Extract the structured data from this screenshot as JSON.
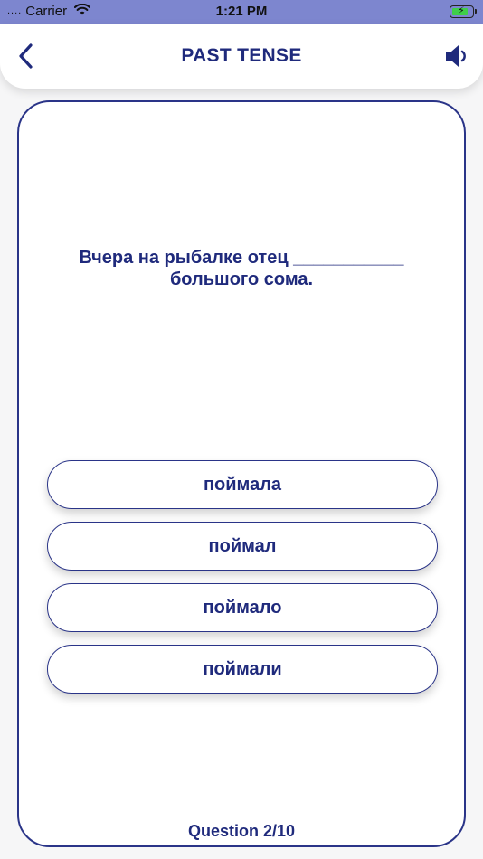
{
  "status_bar": {
    "carrier": "Carrier",
    "time": "1:21 PM",
    "signal_dots": "....",
    "battery_icon": "battery-charging-icon",
    "wifi_icon": "wifi-icon"
  },
  "header": {
    "title": "PAST TENSE",
    "back_icon": "chevron-left-icon",
    "sound_icon": "speaker-icon"
  },
  "quiz": {
    "question": "Вчера на рыбалке отец ___________ большого сома.",
    "answers": [
      {
        "label": "поймала"
      },
      {
        "label": "поймал"
      },
      {
        "label": "поймало"
      },
      {
        "label": "поймали"
      }
    ],
    "progress": "Question 2/10"
  },
  "colors": {
    "accent": "#1f2a7c",
    "status_bar": "#7d86cf",
    "battery": "#3fcf4a",
    "background": "#f6f6f7"
  }
}
